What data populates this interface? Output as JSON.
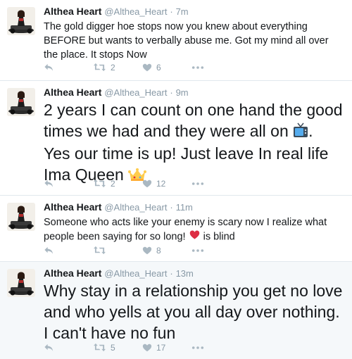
{
  "tweets": [
    {
      "name": "Althea Heart",
      "handle": "@Althea_Heart",
      "separator": "·",
      "time": "7m",
      "text": "The gold digger hoe stops now you knew about everything BEFORE but wants to verbally abuse me. Got my mind all over the place. It stops Now",
      "retweets": "2",
      "likes": "6"
    },
    {
      "name": "Althea Heart",
      "handle": "@Althea_Heart",
      "separator": "·",
      "time": "9m",
      "text_part1": "2 years I can count on one hand the good times we had and they were all on ",
      "text_part2": ". Yes our time is up! Just leave   In real life Ima Queen ",
      "emoji1": "television-emoji",
      "emoji2": "crown-emoji",
      "retweets": "2",
      "likes": "12"
    },
    {
      "name": "Althea Heart",
      "handle": "@Althea_Heart",
      "separator": "·",
      "time": "11m",
      "text_part1": "Someone who acts like your enemy is scary now I realize what people been saying for so long! ",
      "text_part2": " is blind",
      "emoji1": "red-heart-emoji",
      "retweets": "",
      "likes": "8"
    },
    {
      "name": "Althea Heart",
      "handle": "@Althea_Heart",
      "separator": "·",
      "time": "13m",
      "text": "Why stay in a relationship you get no love and who yells at you all day over nothing. I can't have no fun",
      "retweets": "5",
      "likes": "17"
    }
  ],
  "icons": {
    "reply": "reply-icon",
    "retweet": "retweet-icon",
    "like": "heart-icon",
    "more": "more-icon"
  },
  "colors": {
    "icon_gray": "#aab8c2",
    "count_gray": "#8899a6",
    "divider": "#e1e8ed",
    "highlight_bg": "#f5f8fa"
  }
}
